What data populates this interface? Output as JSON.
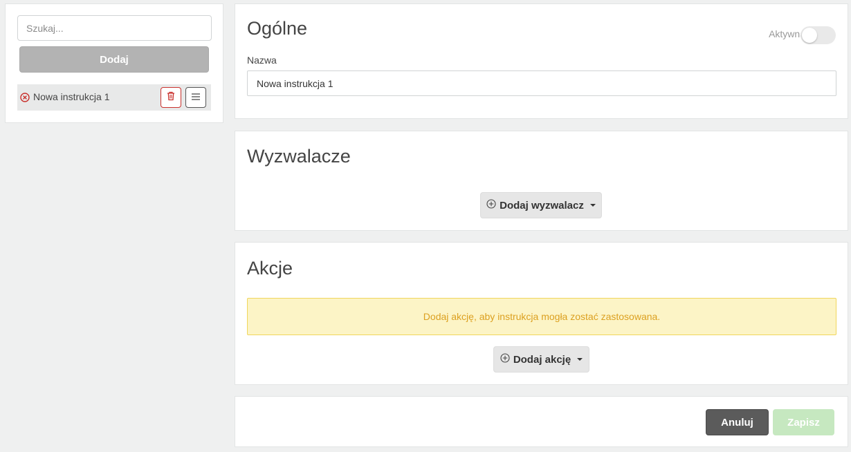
{
  "sidebar": {
    "search_placeholder": "Szukaj...",
    "add_label": "Dodaj",
    "items": [
      {
        "label": "Nowa instrukcja 1",
        "status_icon": "error-circle-icon",
        "status_color": "#c9302c"
      }
    ]
  },
  "general": {
    "title": "Ogólne",
    "active_label": "Aktywna",
    "active": false,
    "name_label": "Nazwa",
    "name_value": "Nowa instrukcja 1"
  },
  "triggers": {
    "title": "Wyzwalacze",
    "add_label": "Dodaj wyzwalacz"
  },
  "actions": {
    "title": "Akcje",
    "warning": "Dodaj akcję, aby instrukcja mogła zostać zastosowana.",
    "add_label": "Dodaj akcję"
  },
  "footer": {
    "cancel_label": "Anuluj",
    "save_label": "Zapisz"
  },
  "colors": {
    "danger": "#c9302c",
    "warning_bg": "#fcf4c6",
    "warning_text": "#dca020",
    "save_disabled": "#c6e8c0"
  }
}
